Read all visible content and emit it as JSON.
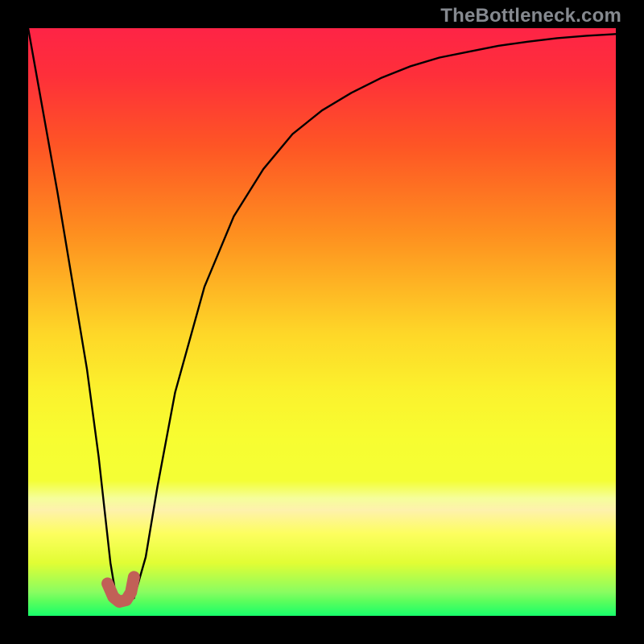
{
  "watermark": "TheBottleneck.com",
  "chart_data": {
    "type": "line",
    "title": "",
    "xlabel": "",
    "ylabel": "",
    "xlim": [
      0,
      100
    ],
    "ylim": [
      0,
      100
    ],
    "series": [
      {
        "name": "bottleneck-curve",
        "x": [
          0,
          5,
          10,
          12,
          14,
          15,
          16,
          18,
          20,
          22,
          25,
          30,
          35,
          40,
          45,
          50,
          55,
          60,
          65,
          70,
          75,
          80,
          85,
          90,
          95,
          100
        ],
        "values": [
          100,
          72,
          42,
          27,
          9,
          3,
          2,
          3,
          10,
          22,
          38,
          56,
          68,
          76,
          82,
          86,
          89,
          91.5,
          93.5,
          95,
          96,
          97,
          97.7,
          98.3,
          98.7,
          99
        ]
      }
    ],
    "marker": {
      "name": "highlight-segment",
      "color": "#c16057",
      "x": [
        13.5,
        14.5,
        15.5,
        16.7,
        17.5,
        18
      ],
      "values": [
        5.5,
        3.2,
        2.4,
        2.7,
        4.0,
        6.6
      ]
    }
  },
  "gradient_background": {
    "top_color": "#fe2446",
    "mid_color": "#fed728",
    "bottom_color": "#18fe6b"
  }
}
